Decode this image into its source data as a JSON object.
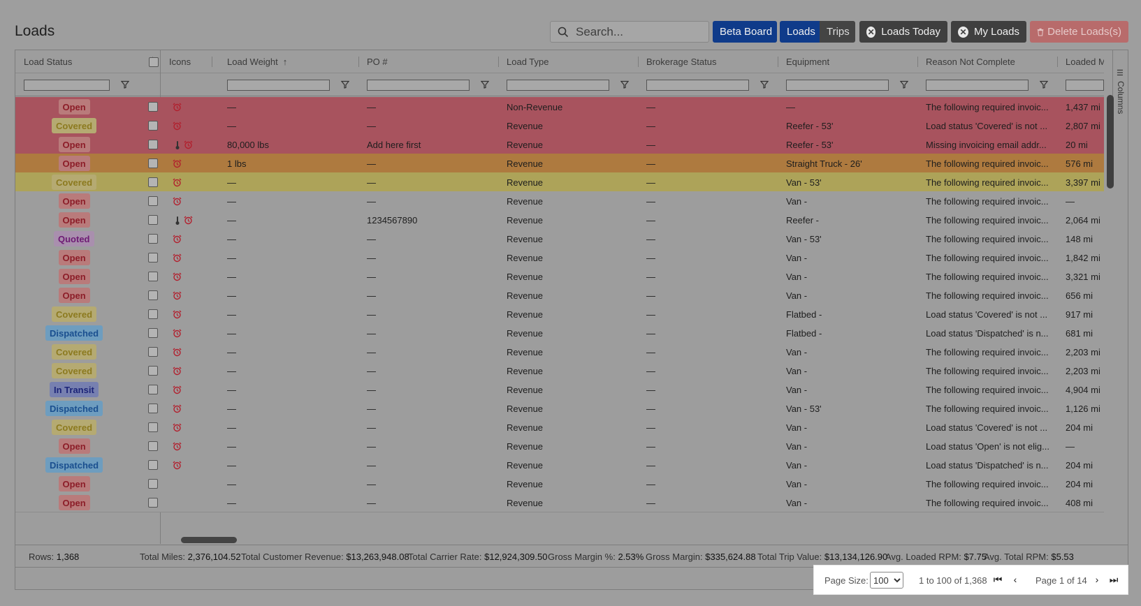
{
  "title": "Loads",
  "search": {
    "placeholder": "Search..."
  },
  "toolbar": {
    "beta_board": "Beta Board",
    "loads": "Loads",
    "trips": "Trips",
    "loads_today": "Loads Today",
    "my_loads": "My Loads",
    "delete_loads": "Delete Loads(s)"
  },
  "columns": {
    "load_status": "Load Status",
    "icons": "Icons",
    "load_weight": "Load Weight",
    "po": "PO #",
    "load_type": "Load Type",
    "brokerage_status": "Brokerage Status",
    "equipment": "Equipment",
    "reason": "Reason Not Complete",
    "loaded_miles": "Loaded Mile"
  },
  "side_panel": {
    "label": "Columns"
  },
  "rows": [
    {
      "status": "Open",
      "cls": "b-open",
      "bg": "red",
      "thermo": false,
      "alarm": true,
      "weight": "—",
      "po": "—",
      "type": "Non-Revenue",
      "brokerage": "—",
      "equipment": "—",
      "reason": "The following required invoic...",
      "miles": "1,437 mi"
    },
    {
      "status": "Covered",
      "cls": "b-covered",
      "bg": "red",
      "thermo": false,
      "alarm": true,
      "weight": "—",
      "po": "—",
      "type": "Revenue",
      "brokerage": "—",
      "equipment": "Reefer - 53'",
      "reason": "Load status 'Covered' is not ...",
      "miles": "2,807 mi"
    },
    {
      "status": "Open",
      "cls": "b-open",
      "bg": "red",
      "thermo": true,
      "alarm": true,
      "weight": "80,000 lbs",
      "po": "Add here first",
      "type": "Revenue",
      "brokerage": "—",
      "equipment": "Reefer - 53'",
      "reason": "Missing invoicing email addr...",
      "miles": "20 mi"
    },
    {
      "status": "Open",
      "cls": "b-open",
      "bg": "orange",
      "thermo": false,
      "alarm": true,
      "weight": "1 lbs",
      "po": "—",
      "type": "Revenue",
      "brokerage": "—",
      "equipment": "Straight Truck - 26'",
      "reason": "The following required invoic...",
      "miles": "576 mi"
    },
    {
      "status": "Covered",
      "cls": "b-covered",
      "bg": "yellow",
      "thermo": false,
      "alarm": true,
      "weight": "—",
      "po": "—",
      "type": "Revenue",
      "brokerage": "—",
      "equipment": "Van - 53'",
      "reason": "The following required invoic...",
      "miles": "3,397 mi"
    },
    {
      "status": "Open",
      "cls": "b-open",
      "bg": "grey",
      "thermo": false,
      "alarm": true,
      "weight": "—",
      "po": "—",
      "type": "Revenue",
      "brokerage": "—",
      "equipment": "Van -",
      "reason": "The following required invoic...",
      "miles": "—"
    },
    {
      "status": "Open",
      "cls": "b-open",
      "bg": "grey",
      "thermo": true,
      "alarm": true,
      "weight": "—",
      "po": "1234567890",
      "type": "Revenue",
      "brokerage": "—",
      "equipment": "Reefer -",
      "reason": "The following required invoic...",
      "miles": "2,064 mi"
    },
    {
      "status": "Quoted",
      "cls": "b-quoted",
      "bg": "grey",
      "thermo": false,
      "alarm": true,
      "weight": "—",
      "po": "—",
      "type": "Revenue",
      "brokerage": "—",
      "equipment": "Van - 53'",
      "reason": "The following required invoic...",
      "miles": "148 mi"
    },
    {
      "status": "Open",
      "cls": "b-open",
      "bg": "grey",
      "thermo": false,
      "alarm": true,
      "weight": "—",
      "po": "—",
      "type": "Revenue",
      "brokerage": "—",
      "equipment": "Van -",
      "reason": "The following required invoic...",
      "miles": "1,842 mi"
    },
    {
      "status": "Open",
      "cls": "b-open",
      "bg": "grey",
      "thermo": false,
      "alarm": true,
      "weight": "—",
      "po": "—",
      "type": "Revenue",
      "brokerage": "—",
      "equipment": "Van -",
      "reason": "The following required invoic...",
      "miles": "3,321 mi"
    },
    {
      "status": "Open",
      "cls": "b-open",
      "bg": "grey",
      "thermo": false,
      "alarm": true,
      "weight": "—",
      "po": "—",
      "type": "Revenue",
      "brokerage": "—",
      "equipment": "Van -",
      "reason": "The following required invoic...",
      "miles": "656 mi"
    },
    {
      "status": "Covered",
      "cls": "b-covered",
      "bg": "grey",
      "thermo": false,
      "alarm": true,
      "weight": "—",
      "po": "—",
      "type": "Revenue",
      "brokerage": "—",
      "equipment": "Flatbed -",
      "reason": "Load status 'Covered' is not ...",
      "miles": "917 mi"
    },
    {
      "status": "Dispatched",
      "cls": "b-dispatched",
      "bg": "grey",
      "thermo": false,
      "alarm": true,
      "weight": "—",
      "po": "—",
      "type": "Revenue",
      "brokerage": "—",
      "equipment": "Flatbed -",
      "reason": "Load status 'Dispatched' is n...",
      "miles": "681 mi"
    },
    {
      "status": "Covered",
      "cls": "b-covered",
      "bg": "grey",
      "thermo": false,
      "alarm": true,
      "weight": "—",
      "po": "—",
      "type": "Revenue",
      "brokerage": "—",
      "equipment": "Van -",
      "reason": "The following required invoic...",
      "miles": "2,203 mi"
    },
    {
      "status": "Covered",
      "cls": "b-covered",
      "bg": "grey",
      "thermo": false,
      "alarm": true,
      "weight": "—",
      "po": "—",
      "type": "Revenue",
      "brokerage": "—",
      "equipment": "Van -",
      "reason": "The following required invoic...",
      "miles": "2,203 mi"
    },
    {
      "status": "In Transit",
      "cls": "b-intransit",
      "bg": "grey",
      "thermo": false,
      "alarm": true,
      "weight": "—",
      "po": "—",
      "type": "Revenue",
      "brokerage": "—",
      "equipment": "Van -",
      "reason": "The following required invoic...",
      "miles": "4,904 mi"
    },
    {
      "status": "Dispatched",
      "cls": "b-dispatched",
      "bg": "grey",
      "thermo": false,
      "alarm": true,
      "weight": "—",
      "po": "—",
      "type": "Revenue",
      "brokerage": "—",
      "equipment": "Van - 53'",
      "reason": "The following required invoic...",
      "miles": "1,126 mi"
    },
    {
      "status": "Covered",
      "cls": "b-covered",
      "bg": "grey",
      "thermo": false,
      "alarm": true,
      "weight": "—",
      "po": "—",
      "type": "Revenue",
      "brokerage": "—",
      "equipment": "Van -",
      "reason": "Load status 'Covered' is not ...",
      "miles": "204 mi"
    },
    {
      "status": "Open",
      "cls": "b-open",
      "bg": "grey",
      "thermo": false,
      "alarm": true,
      "weight": "—",
      "po": "—",
      "type": "Revenue",
      "brokerage": "—",
      "equipment": "Van -",
      "reason": "Load status 'Open' is not elig...",
      "miles": "—"
    },
    {
      "status": "Dispatched",
      "cls": "b-dispatched",
      "bg": "grey",
      "thermo": false,
      "alarm": true,
      "weight": "—",
      "po": "—",
      "type": "Revenue",
      "brokerage": "—",
      "equipment": "Van -",
      "reason": "Load status 'Dispatched' is n...",
      "miles": "204 mi"
    },
    {
      "status": "Open",
      "cls": "b-open",
      "bg": "grey",
      "thermo": false,
      "alarm": false,
      "weight": "—",
      "po": "—",
      "type": "Revenue",
      "brokerage": "—",
      "equipment": "Van -",
      "reason": "The following required invoic...",
      "miles": "204 mi"
    },
    {
      "status": "Open",
      "cls": "b-open",
      "bg": "grey",
      "thermo": false,
      "alarm": false,
      "weight": "—",
      "po": "—",
      "type": "Revenue",
      "brokerage": "—",
      "equipment": "Van -",
      "reason": "The following required invoic...",
      "miles": "408 mi"
    }
  ],
  "totals": {
    "rows_label": "Rows:",
    "rows": "1,368",
    "miles_label": "Total Miles:",
    "miles": "2,376,104.52",
    "cust_rev_label": "Total Customer Revenue:",
    "cust_rev": "$13,263,948.08",
    "carrier_label": "Total Carrier Rate:",
    "carrier": "$12,924,309.50",
    "gm_pct_label": "Gross Margin %:",
    "gm_pct": "2.53%",
    "gm_label": "Gross Margin:",
    "gm": "$335,624.88",
    "trip_label": "Total Trip Value:",
    "trip": "$13,134,126.90",
    "rpm_label": "Avg. Loaded RPM:",
    "rpm": "$7.75",
    "trpm_label": "Avg. Total RPM:",
    "trpm": "$5.53"
  },
  "pager": {
    "page_size_label": "Page Size:",
    "page_size": "100",
    "range": "1 to 100 of 1,368",
    "page_info": "Page 1 of 14"
  }
}
